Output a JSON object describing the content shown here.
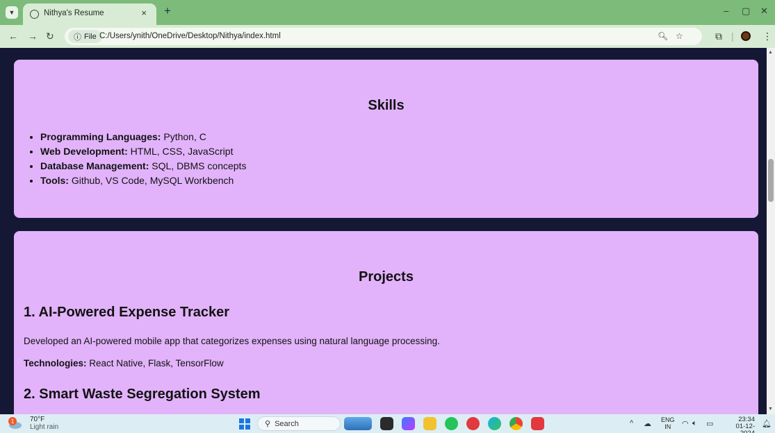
{
  "browser": {
    "tab_title": "Nithya's Resume",
    "tab_close": "×",
    "new_tab": "+",
    "file_chip": "File",
    "url": "C:/Users/ynith/OneDrive/Desktop/Nithya/index.html",
    "window_controls": [
      "–",
      "▢",
      "✕"
    ]
  },
  "skills": {
    "heading": "Skills",
    "items": [
      {
        "label": "Programming Languages:",
        "value": " Python, C"
      },
      {
        "label": "Web Development:",
        "value": " HTML, CSS, JavaScript"
      },
      {
        "label": "Database Management:",
        "value": " SQL, DBMS concepts"
      },
      {
        "label": "Tools:",
        "value": " Github, VS Code, MySQL Workbench"
      }
    ]
  },
  "projects": {
    "heading": "Projects",
    "items": [
      {
        "title": "1. AI-Powered Expense Tracker",
        "description": "Developed an AI-powered mobile app that categorizes expenses using natural language processing.",
        "tech_label": "Technologies:",
        "tech_value": " React Native, Flask, TensorFlow"
      },
      {
        "title": "2. Smart Waste Segregation System"
      }
    ]
  },
  "taskbar": {
    "weather_temp": "70°F",
    "weather_desc": "Light rain",
    "weather_badge": "1",
    "search_label": "Search",
    "lang_top": "ENG",
    "lang_bottom": "IN",
    "time": "23:34",
    "date": "01-12-2024"
  },
  "colors": {
    "tab_strip": "#7dbb7b",
    "page_background": "#151834",
    "card_background": "#e2b3fb"
  }
}
